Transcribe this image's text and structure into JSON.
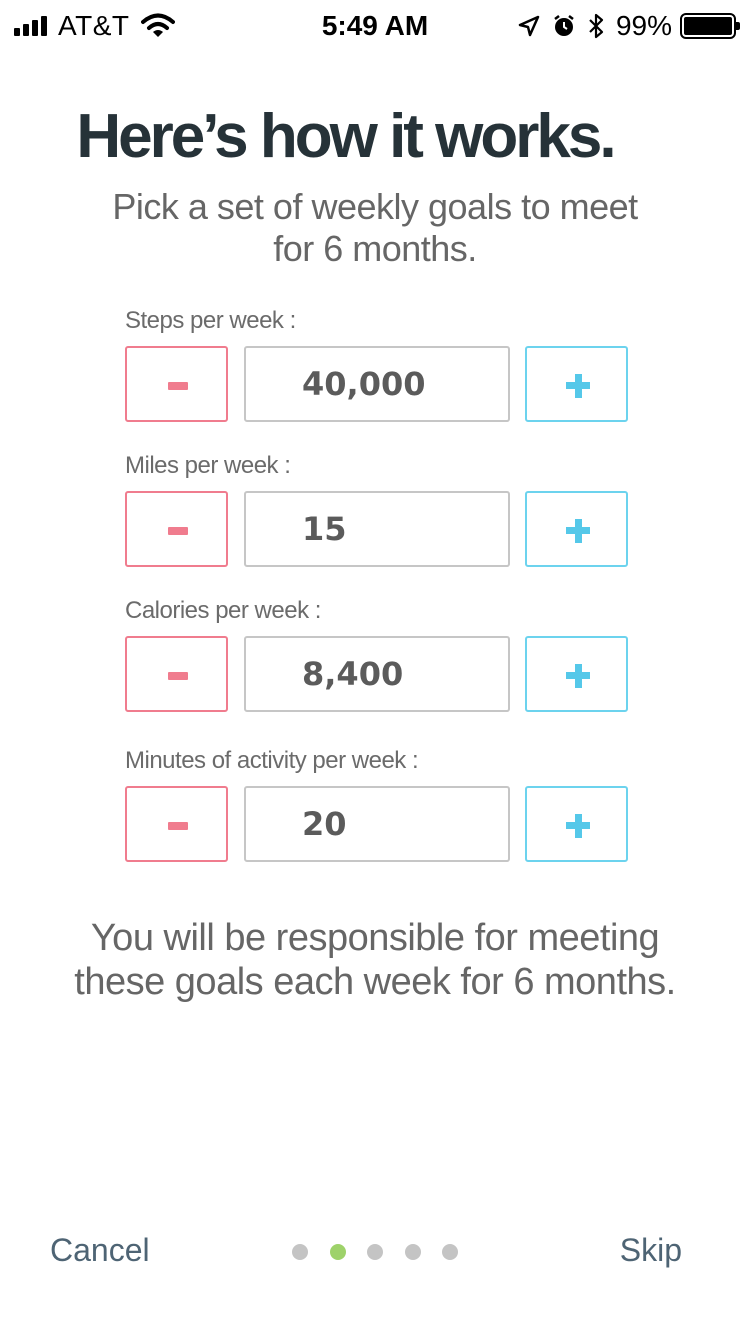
{
  "status_bar": {
    "carrier": "AT&T",
    "time": "5:49 AM",
    "battery_percent": "99%",
    "icons": [
      "signal-icon",
      "wifi-icon",
      "location-arrow-icon",
      "alarm-icon",
      "bluetooth-icon",
      "battery-icon"
    ]
  },
  "header": {
    "title": "Here’s how it works.",
    "subtitle": "Pick a set of  weekly goals to meet for 6 months."
  },
  "goals": [
    {
      "label": "Steps per week :",
      "value": "40,000"
    },
    {
      "label": "Miles per week :",
      "value": "15"
    },
    {
      "label": "Calories per week :",
      "value": "8,400"
    },
    {
      "label": "Minutes of activity per week :",
      "value": "20"
    }
  ],
  "controls": {
    "decrement_icon": "minus-icon",
    "increment_icon": "plus-icon"
  },
  "note": "You will be responsible for meeting these goals each week for 6 months.",
  "footer": {
    "cancel_label": "Cancel",
    "skip_label": "Skip",
    "page_count": 5,
    "current_page": 2
  },
  "colors": {
    "title": "#263238",
    "minus_accent": "#f07c8e",
    "plus_accent": "#55c8e9",
    "active_dot": "#9ed26a",
    "inactive_dot": "#c4c4c4",
    "footer_link": "#4e6474"
  }
}
